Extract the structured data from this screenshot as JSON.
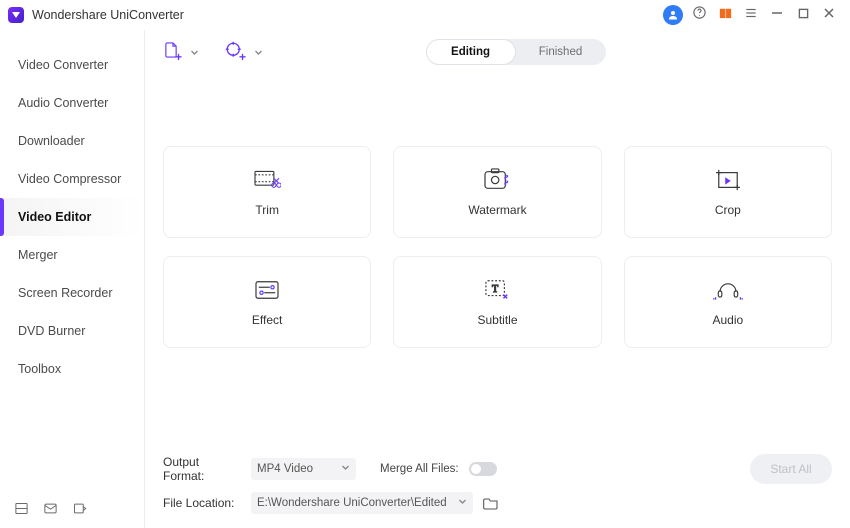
{
  "titlebar": {
    "app_name": "Wondershare UniConverter"
  },
  "sidebar": {
    "items": [
      {
        "label": "Video Converter"
      },
      {
        "label": "Audio Converter"
      },
      {
        "label": "Downloader"
      },
      {
        "label": "Video Compressor"
      },
      {
        "label": "Video Editor"
      },
      {
        "label": "Merger"
      },
      {
        "label": "Screen Recorder"
      },
      {
        "label": "DVD Burner"
      },
      {
        "label": "Toolbox"
      }
    ],
    "active_index": 4
  },
  "tabs": {
    "editing": "Editing",
    "finished": "Finished",
    "active": "editing"
  },
  "tools": [
    {
      "id": "trim",
      "label": "Trim",
      "icon": "trim-icon"
    },
    {
      "id": "watermark",
      "label": "Watermark",
      "icon": "watermark-icon"
    },
    {
      "id": "crop",
      "label": "Crop",
      "icon": "crop-icon"
    },
    {
      "id": "effect",
      "label": "Effect",
      "icon": "effect-icon"
    },
    {
      "id": "subtitle",
      "label": "Subtitle",
      "icon": "subtitle-icon"
    },
    {
      "id": "audio",
      "label": "Audio",
      "icon": "audio-icon"
    }
  ],
  "footer": {
    "output_format_label": "Output Format:",
    "output_format_value": "MP4 Video",
    "merge_label": "Merge All Files:",
    "merge_on": false,
    "file_location_label": "File Location:",
    "file_location_value": "E:\\Wondershare UniConverter\\Edited",
    "start_all_label": "Start All"
  }
}
